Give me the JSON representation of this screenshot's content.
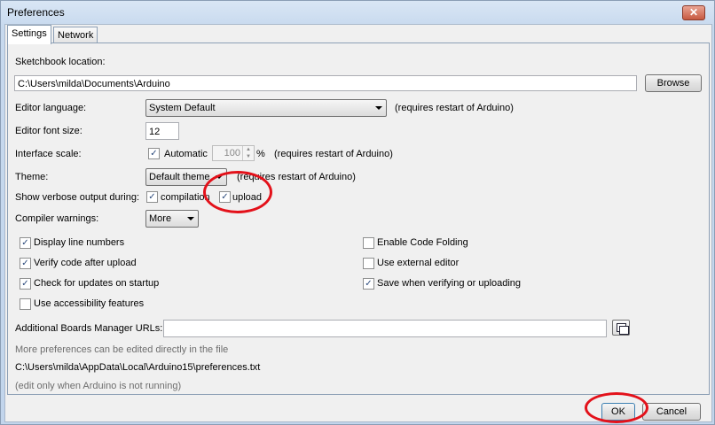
{
  "window": {
    "title": "Preferences",
    "close_glyph": "✕"
  },
  "tabs": [
    {
      "label": "Settings",
      "active": true
    },
    {
      "label": "Network",
      "active": false
    }
  ],
  "sketchbook": {
    "label": "Sketchbook location:",
    "value": "C:\\Users\\milda\\Documents\\Arduino",
    "browse_label": "Browse"
  },
  "editor_language": {
    "label": "Editor language:",
    "value": "System Default",
    "note": "(requires restart of Arduino)"
  },
  "font_size": {
    "label": "Editor font size:",
    "value": "12"
  },
  "interface_scale": {
    "label": "Interface scale:",
    "automatic_label": "Automatic",
    "automatic_checked": true,
    "value": "100",
    "unit": "%",
    "note": "(requires restart of Arduino)"
  },
  "theme": {
    "label": "Theme:",
    "value": "Default theme",
    "note": "(requires restart of Arduino)"
  },
  "verbose": {
    "label": "Show verbose output during:",
    "compilation_label": "compilation",
    "compilation_checked": true,
    "upload_label": "upload",
    "upload_checked": true
  },
  "compiler_warnings": {
    "label": "Compiler warnings:",
    "value": "More"
  },
  "options_left": [
    {
      "label": "Display line numbers",
      "checked": true
    },
    {
      "label": "Verify code after upload",
      "checked": true
    },
    {
      "label": "Check for updates on startup",
      "checked": true
    },
    {
      "label": "Use accessibility features",
      "checked": false
    }
  ],
  "options_right": [
    {
      "label": "Enable Code Folding",
      "checked": false
    },
    {
      "label": "Use external editor",
      "checked": false
    },
    {
      "label": "Save when verifying or uploading",
      "checked": true
    }
  ],
  "boards_urls": {
    "label": "Additional Boards Manager URLs:",
    "value": ""
  },
  "footer_notes": {
    "more_prefs": "More preferences can be edited directly in the file",
    "prefs_path": "C:\\Users\\milda\\AppData\\Local\\Arduino15\\preferences.txt",
    "edit_note": "(edit only when Arduino is not running)"
  },
  "buttons": {
    "ok_label": "OK",
    "cancel_label": "Cancel"
  },
  "check_glyph": "✓",
  "annotation_color": "#e3111a"
}
